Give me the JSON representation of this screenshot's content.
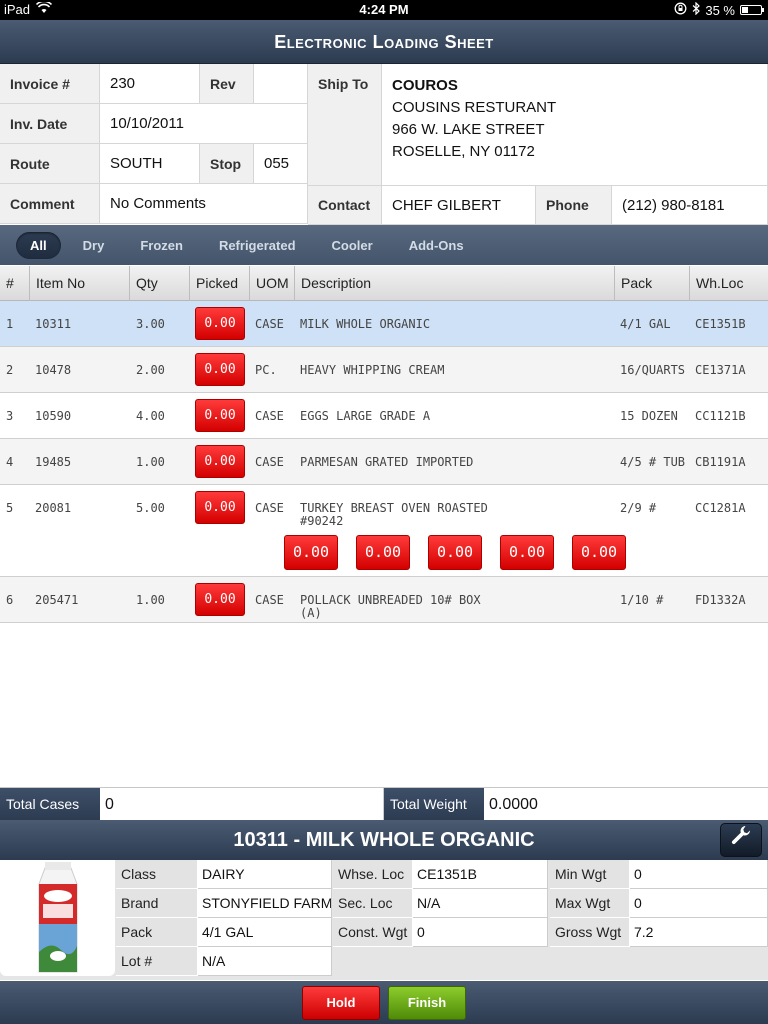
{
  "status_bar": {
    "device": "iPad",
    "time": "4:24 PM",
    "battery_text": "35 %",
    "battery_level": 0.35
  },
  "title": "Electronic Loading Sheet",
  "header": {
    "invoice_label": "Invoice #",
    "invoice_value": "230",
    "rev_label": "Rev",
    "rev_value": "",
    "inv_date_label": "Inv. Date",
    "inv_date_value": "10/10/2011",
    "route_label": "Route",
    "route_value": "SOUTH",
    "stop_label": "Stop",
    "stop_value": "055",
    "comment_label": "Comment",
    "comment_value": "No Comments",
    "ship_to_label": "Ship To",
    "ship_to_code": "COUROS",
    "ship_to_name": "COUSINS RESTURANT",
    "ship_to_street": "966 W. LAKE STREET",
    "ship_to_city": "ROSELLE, NY 01172",
    "contact_label": "Contact",
    "contact_value": "CHEF GILBERT",
    "phone_label": "Phone",
    "phone_value": "(212) 980-8181"
  },
  "tabs": [
    "All",
    "Dry",
    "Frozen",
    "Refrigerated",
    "Cooler",
    "Add-Ons"
  ],
  "active_tab": "All",
  "columns": {
    "num": "#",
    "item_no": "Item No",
    "qty": "Qty",
    "picked": "Picked",
    "uom": "UOM",
    "description": "Description",
    "pack": "Pack",
    "whloc": "Wh.Loc"
  },
  "rows": [
    {
      "num": "1",
      "item_no": "10311",
      "qty": "3.00",
      "picked": "0.00",
      "uom": "CASE",
      "description": "MILK WHOLE ORGANIC",
      "description2": "",
      "pack": "4/1 GAL",
      "whloc": "CE1351B"
    },
    {
      "num": "2",
      "item_no": "10478",
      "qty": "2.00",
      "picked": "0.00",
      "uom": "PC.",
      "description": "HEAVY WHIPPING CREAM",
      "description2": "",
      "pack": "16/QUARTS",
      "whloc": "CE1371A"
    },
    {
      "num": "3",
      "item_no": "10590",
      "qty": "4.00",
      "picked": "0.00",
      "uom": "CASE",
      "description": "EGGS LARGE GRADE A",
      "description2": "",
      "pack": "15 DOZEN",
      "whloc": "CC1121B"
    },
    {
      "num": "4",
      "item_no": "19485",
      "qty": "1.00",
      "picked": "0.00",
      "uom": "CASE",
      "description": "PARMESAN GRATED IMPORTED",
      "description2": "",
      "pack": "4/5 # TUB",
      "whloc": "CB1191A"
    },
    {
      "num": "5",
      "item_no": "20081",
      "qty": "5.00",
      "picked": "0.00",
      "uom": "CASE",
      "description": "TURKEY BREAST OVEN ROASTED",
      "description2": "#90242",
      "pack": "2/9 #",
      "whloc": "CC1281A",
      "sub_picks": [
        "0.00",
        "0.00",
        "0.00",
        "0.00",
        "0.00"
      ]
    },
    {
      "num": "6",
      "item_no": "205471",
      "qty": "1.00",
      "picked": "0.00",
      "uom": "CASE",
      "description": "POLLACK UNBREADED 10# BOX",
      "description2": "(A)",
      "pack": "1/10 #",
      "whloc": "FD1332A"
    }
  ],
  "totals": {
    "cases_label": "Total Cases",
    "cases_value": "0",
    "weight_label": "Total Weight",
    "weight_value": "0.0000"
  },
  "detail": {
    "title": "10311 - MILK WHOLE ORGANIC",
    "class_label": "Class",
    "class_value": "DAIRY",
    "brand_label": "Brand",
    "brand_value": "STONYFIELD FARM",
    "pack_label": "Pack",
    "pack_value": "4/1 GAL",
    "lot_label": "Lot #",
    "lot_value": "N/A",
    "whse_loc_label": "Whse. Loc",
    "whse_loc_value": "CE1351B",
    "sec_loc_label": "Sec. Loc",
    "sec_loc_value": "N/A",
    "const_wgt_label": "Const. Wgt",
    "const_wgt_value": "0",
    "min_wgt_label": "Min Wgt",
    "min_wgt_value": "0",
    "max_wgt_label": "Max Wgt",
    "max_wgt_value": "0",
    "gross_wgt_label": "Gross Wgt",
    "gross_wgt_value": "7.2"
  },
  "footer": {
    "hold_label": "Hold",
    "finish_label": "Finish"
  }
}
